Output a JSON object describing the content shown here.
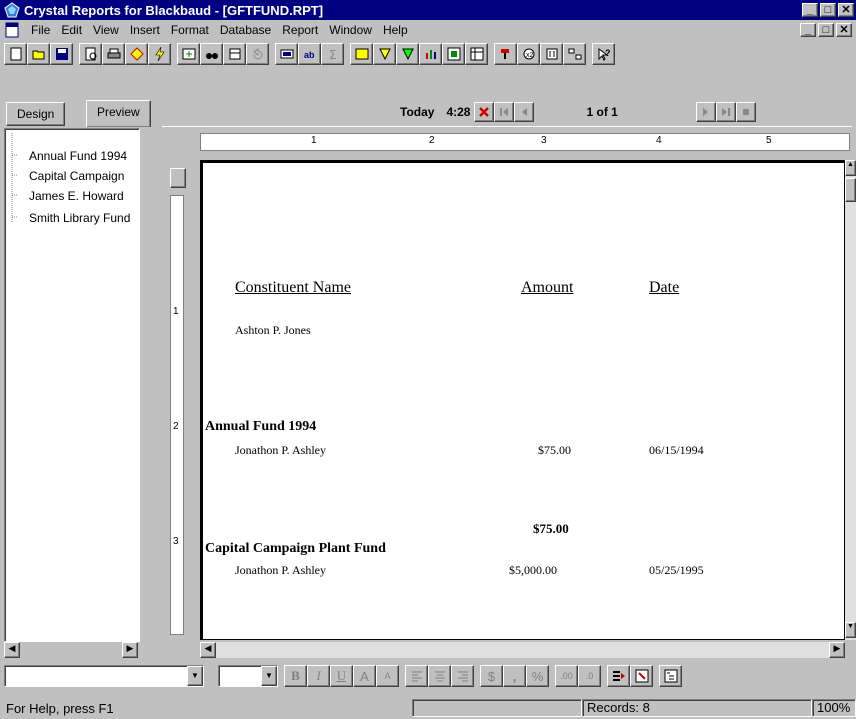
{
  "window": {
    "title": "Crystal Reports for Blackbaud - [GFTFUND.RPT]",
    "minimize": "_",
    "maximize": "□",
    "close": "✕"
  },
  "menubar": {
    "items": [
      "File",
      "Edit",
      "View",
      "Insert",
      "Format",
      "Database",
      "Report",
      "Window",
      "Help"
    ]
  },
  "tabs": {
    "design": "Design",
    "preview": "Preview"
  },
  "navigation": {
    "today_label": "Today",
    "time": "4:28",
    "page_indicator": "1 of 1"
  },
  "group_tree": {
    "items": [
      "Annual Fund 1994",
      "Capital Campaign",
      "James E. Howard",
      "Smith Library Fund"
    ]
  },
  "ruler": {
    "h_marks": [
      "1",
      "2",
      "3",
      "4",
      "5"
    ],
    "v_marks": [
      "1",
      "2",
      "3"
    ]
  },
  "report": {
    "headers": {
      "name": "Constituent Name",
      "amount": "Amount",
      "date": "Date"
    },
    "first_name": "Ashton P. Jones",
    "groups": [
      {
        "title": "Annual Fund 1994",
        "name": "Jonathon P. Ashley",
        "amount": "$75.00",
        "date": "06/15/1994",
        "subtotal": "$75.00"
      },
      {
        "title": "Capital Campaign Plant Fund",
        "name": "Jonathon P. Ashley",
        "amount": "$5,000.00",
        "date": "05/25/1995"
      }
    ]
  },
  "format_bar": {
    "bold": "B",
    "italic": "I",
    "underline": "U",
    "currency": "$",
    "comma": ",",
    "percent": "%"
  },
  "statusbar": {
    "help": "For Help, press F1",
    "records": "Records: 8",
    "zoom": "100%"
  },
  "colors": {
    "title_bg": "#000080",
    "face": "#c0c0c0"
  }
}
